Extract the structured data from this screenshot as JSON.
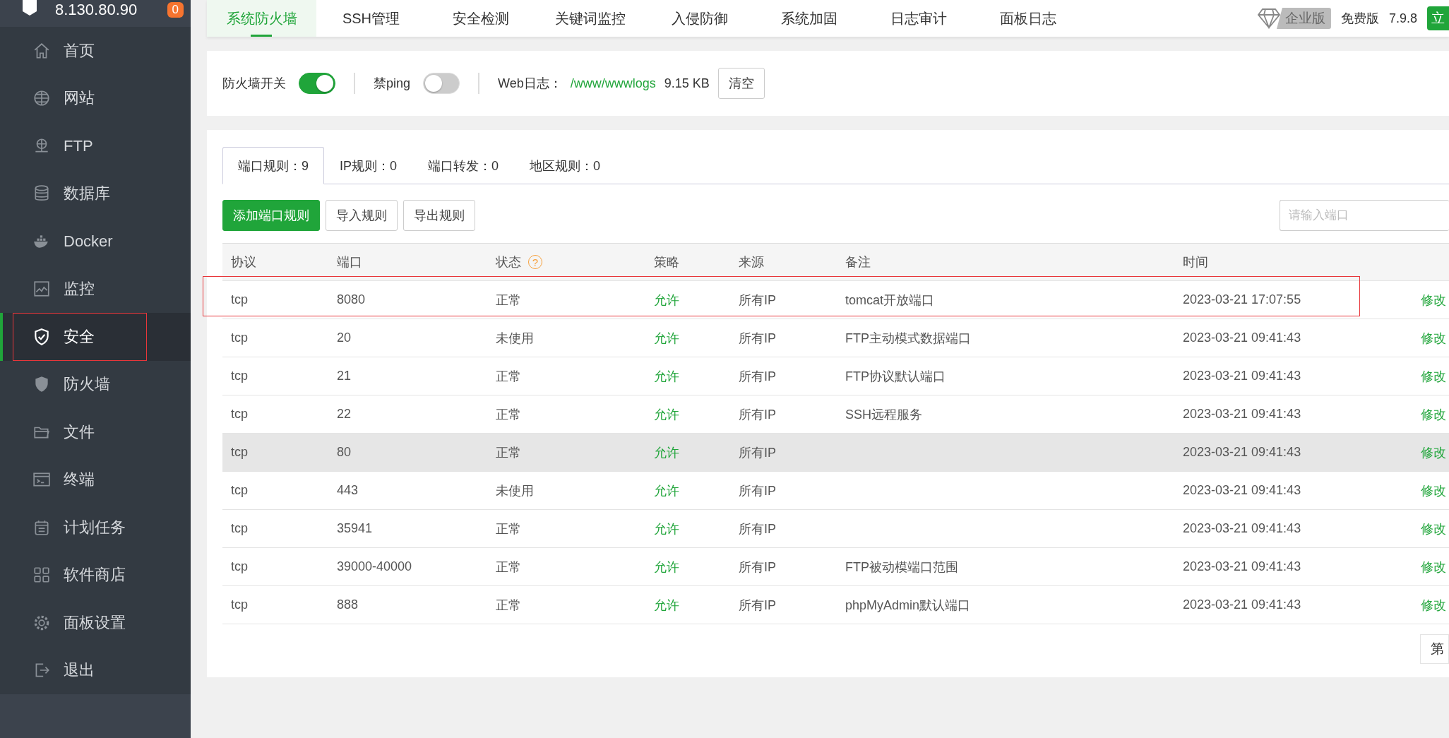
{
  "sidebar": {
    "server": "8.130.80.90",
    "badge": "0",
    "items": [
      {
        "label": "首页",
        "selected": false,
        "highlighted": false
      },
      {
        "label": "网站",
        "selected": false,
        "highlighted": false
      },
      {
        "label": "FTP",
        "selected": false,
        "highlighted": false
      },
      {
        "label": "数据库",
        "selected": false,
        "highlighted": false
      },
      {
        "label": "Docker",
        "selected": false,
        "highlighted": false
      },
      {
        "label": "监控",
        "selected": false,
        "highlighted": false
      },
      {
        "label": "安全",
        "selected": true,
        "highlighted": true
      },
      {
        "label": "防火墙",
        "selected": false,
        "highlighted": false
      },
      {
        "label": "文件",
        "selected": false,
        "highlighted": false
      },
      {
        "label": "终端",
        "selected": false,
        "highlighted": false
      },
      {
        "label": "计划任务",
        "selected": false,
        "highlighted": false
      },
      {
        "label": "软件商店",
        "selected": false,
        "highlighted": false
      },
      {
        "label": "面板设置",
        "selected": false,
        "highlighted": false
      },
      {
        "label": "退出",
        "selected": false,
        "highlighted": false
      }
    ]
  },
  "top_tabs": [
    {
      "label": "系统防火墙",
      "selected": true
    },
    {
      "label": "SSH管理",
      "selected": false
    },
    {
      "label": "安全检测",
      "selected": false
    },
    {
      "label": "关键词监控",
      "selected": false
    },
    {
      "label": "入侵防御",
      "selected": false
    },
    {
      "label": "系统加固",
      "selected": false
    },
    {
      "label": "日志审计",
      "selected": false
    },
    {
      "label": "面板日志",
      "selected": false
    }
  ],
  "edition": {
    "enterprise": "企业版",
    "free": "免费版",
    "version": "7.9.8",
    "action": "立"
  },
  "toggles": [
    {
      "label": "防火墙开关",
      "on": true
    },
    {
      "label": "禁ping",
      "on": false
    }
  ],
  "web_log": {
    "label": "Web日志：",
    "path": "/www/wwwlogs",
    "size": "9.15 KB",
    "button": "清空"
  },
  "rule_tabs": [
    {
      "label": "端口规则：9",
      "selected": true
    },
    {
      "label": "IP规则：0",
      "selected": false
    },
    {
      "label": "端口转发：0",
      "selected": false
    },
    {
      "label": "地区规则：0",
      "selected": false
    }
  ],
  "actions": [
    {
      "label": "添加端口规则",
      "primary": true
    },
    {
      "label": "导入规则",
      "primary": false
    },
    {
      "label": "导出规则",
      "primary": false
    }
  ],
  "search": {
    "placeholder": "请输入端口"
  },
  "table": {
    "columns": [
      {
        "label": "协议"
      },
      {
        "label": "端口"
      },
      {
        "label": "状态",
        "help": "?"
      },
      {
        "label": "策略"
      },
      {
        "label": "来源"
      },
      {
        "label": "备注"
      },
      {
        "label": "时间"
      }
    ],
    "rows": [
      {
        "protocol": "tcp",
        "port": "8080",
        "status": "正常",
        "policy": "允许",
        "source": "所有IP",
        "note": "tomcat开放端口",
        "time": "2023-03-21 17:07:55",
        "action": "修改",
        "hovered": false,
        "highlighted": true
      },
      {
        "protocol": "tcp",
        "port": "20",
        "status": "未使用",
        "policy": "允许",
        "source": "所有IP",
        "note": "FTP主动模式数据端口",
        "time": "2023-03-21 09:41:43",
        "action": "修改",
        "hovered": false,
        "highlighted": false
      },
      {
        "protocol": "tcp",
        "port": "21",
        "status": "正常",
        "policy": "允许",
        "source": "所有IP",
        "note": "FTP协议默认端口",
        "time": "2023-03-21 09:41:43",
        "action": "修改",
        "hovered": false,
        "highlighted": false
      },
      {
        "protocol": "tcp",
        "port": "22",
        "status": "正常",
        "policy": "允许",
        "source": "所有IP",
        "note": "SSH远程服务",
        "time": "2023-03-21 09:41:43",
        "action": "修改",
        "hovered": false,
        "highlighted": false
      },
      {
        "protocol": "tcp",
        "port": "80",
        "status": "正常",
        "policy": "允许",
        "source": "所有IP",
        "time": "2023-03-21 09:41:43",
        "action": "修改",
        "hovered": true,
        "highlighted": false
      },
      {
        "protocol": "tcp",
        "port": "443",
        "status": "未使用",
        "policy": "允许",
        "source": "所有IP",
        "time": "2023-03-21 09:41:43",
        "action": "修改",
        "hovered": false,
        "highlighted": false
      },
      {
        "protocol": "tcp",
        "port": "35941",
        "status": "正常",
        "policy": "允许",
        "source": "所有IP",
        "time": "2023-03-21 09:41:43",
        "action": "修改",
        "hovered": false,
        "highlighted": false
      },
      {
        "protocol": "tcp",
        "port": "39000-40000",
        "status": "正常",
        "policy": "允许",
        "source": "所有IP",
        "note": "FTP被动模端口范围",
        "time": "2023-03-21 09:41:43",
        "action": "修改",
        "hovered": false,
        "highlighted": false
      },
      {
        "protocol": "tcp",
        "port": "888",
        "status": "正常",
        "policy": "允许",
        "source": "所有IP",
        "note": "phpMyAdmin默认端口",
        "time": "2023-03-21 09:41:43",
        "action": "修改",
        "hovered": false,
        "highlighted": false
      }
    ]
  },
  "pagination": {
    "label": "第"
  }
}
